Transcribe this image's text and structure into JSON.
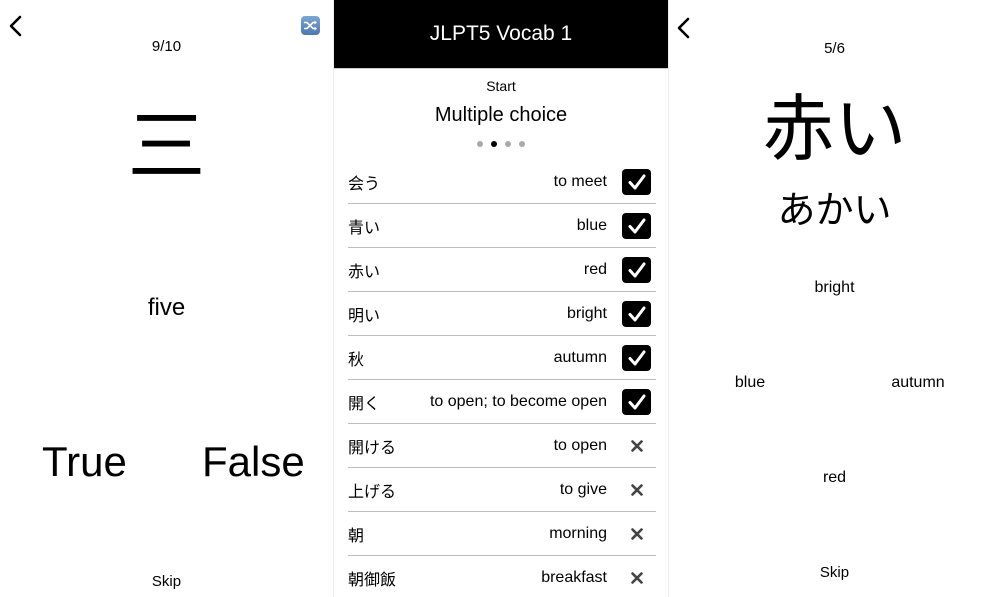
{
  "true_false_screen": {
    "back_icon": "chevron-left-icon",
    "shuffle_icon": "shuffle-icon",
    "progress": "9/10",
    "term": "三",
    "proposed_meaning": "five",
    "true_label": "True",
    "false_label": "False",
    "skip_label": "Skip"
  },
  "deck_screen": {
    "title": "JLPT5 Vocab 1",
    "start_label": "Start",
    "mode_label": "Multiple choice",
    "mode_pages": {
      "count": 4,
      "active_index": 1
    },
    "words": [
      {
        "japanese": "会う",
        "english": "to meet",
        "learned": true
      },
      {
        "japanese": "青い",
        "english": "blue",
        "learned": true
      },
      {
        "japanese": "赤い",
        "english": "red",
        "learned": true
      },
      {
        "japanese": "明い",
        "english": "bright",
        "learned": true
      },
      {
        "japanese": "秋",
        "english": "autumn",
        "learned": true
      },
      {
        "japanese": "開く",
        "english": "to open; to become open",
        "learned": true
      },
      {
        "japanese": "開ける",
        "english": "to open",
        "learned": false
      },
      {
        "japanese": "上げる",
        "english": "to give",
        "learned": false
      },
      {
        "japanese": "朝",
        "english": "morning",
        "learned": false
      },
      {
        "japanese": "朝御飯",
        "english": "breakfast",
        "learned": false
      }
    ]
  },
  "multiple_choice_screen": {
    "back_icon": "chevron-left-icon",
    "progress": "5/6",
    "term": "赤い",
    "reading": "あかい",
    "choices": {
      "top": "bright",
      "left": "blue",
      "right": "autumn",
      "bottom": "red"
    },
    "skip_label": "Skip"
  }
}
